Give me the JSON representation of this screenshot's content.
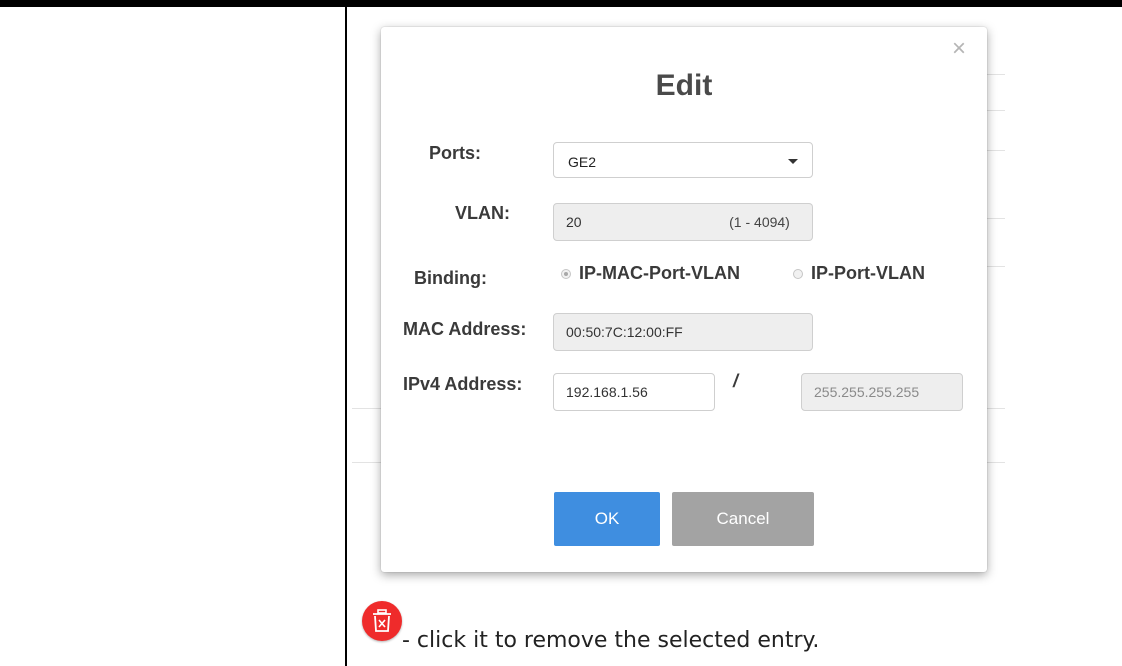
{
  "dialog": {
    "close_glyph": "×",
    "title": "Edit",
    "ports": {
      "label": "Ports:",
      "value": "GE2"
    },
    "vlan": {
      "label": "VLAN:",
      "value": "20",
      "range": "(1 - 4094)"
    },
    "binding": {
      "label": "Binding:",
      "options": [
        {
          "label": "IP-MAC-Port-VLAN",
          "selected": true
        },
        {
          "label": "IP-Port-VLAN",
          "selected": false
        }
      ]
    },
    "mac": {
      "label": "MAC Address:",
      "value": "00:50:7C:12:00:FF"
    },
    "ipv4": {
      "label": "IPv4 Address:",
      "ip": "192.168.1.56",
      "separator": "/",
      "mask": "255.255.255.255"
    },
    "ok_label": "OK",
    "cancel_label": "Cancel"
  },
  "caption": {
    "icon": "trash-icon",
    "text": "- click it to remove the selected entry."
  },
  "colors": {
    "ok_button": "#3f8ee0",
    "cancel_button": "#a3a3a3",
    "trash_icon_bg": "#ef2b2b"
  }
}
